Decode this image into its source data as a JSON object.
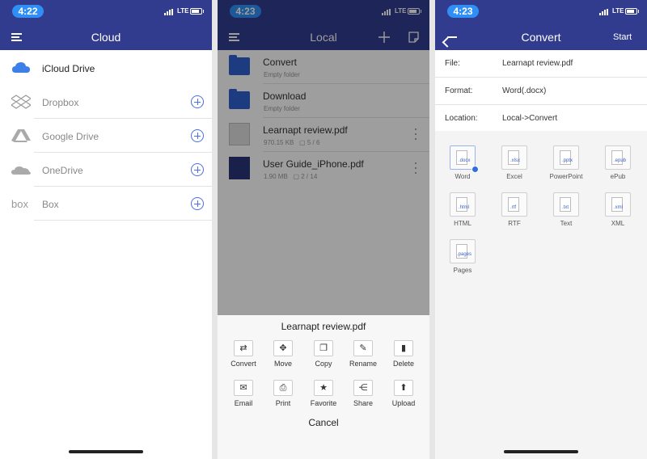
{
  "colors": {
    "header_bg": "#313c8f",
    "accent": "#2f8ff6",
    "folder": "#2f5fd1"
  },
  "screen1": {
    "status_time": "4:22",
    "network": "LTE",
    "title": "Cloud",
    "items": [
      {
        "label": "iCloud Drive",
        "icon": "cloud-icon"
      },
      {
        "label": "Dropbox",
        "icon": "dropbox-icon"
      },
      {
        "label": "Google Drive",
        "icon": "google-drive-icon"
      },
      {
        "label": "OneDrive",
        "icon": "onedrive-icon"
      },
      {
        "label": "Box",
        "icon": "box-icon"
      }
    ]
  },
  "screen2": {
    "status_time": "4:23",
    "network": "LTE",
    "title": "Local",
    "files": [
      {
        "name": "Convert",
        "meta": "Empty folder"
      },
      {
        "name": "Download",
        "meta": "Empty folder"
      },
      {
        "name": "Learnapt review.pdf",
        "size": "970.15 KB",
        "pages": "5 / 6"
      },
      {
        "name": "User Guide_iPhone.pdf",
        "size": "1.90 MB",
        "pages": "2 / 14"
      }
    ],
    "sheet_title": "Learnapt review.pdf",
    "actions": [
      "Convert",
      "Move",
      "Copy",
      "Rename",
      "Delete",
      "Email",
      "Print",
      "Favorite",
      "Share",
      "Upload"
    ],
    "cancel": "Cancel"
  },
  "screen3": {
    "status_time": "4:23",
    "network": "LTE",
    "title": "Convert",
    "start": "Start",
    "info": [
      {
        "key": "File:",
        "value": "Learnapt review.pdf"
      },
      {
        "key": "Format:",
        "value": "Word(.docx)"
      },
      {
        "key": "Location:",
        "value": "Local->Convert"
      }
    ],
    "formats": [
      {
        "label": "Word",
        "ext": ".docx"
      },
      {
        "label": "Excel",
        "ext": ".xlsx"
      },
      {
        "label": "PowerPoint",
        "ext": ".pptx"
      },
      {
        "label": "ePub",
        "ext": ".epub"
      },
      {
        "label": "HTML",
        "ext": ".html"
      },
      {
        "label": "RTF",
        "ext": ".rtf"
      },
      {
        "label": "Text",
        "ext": ".txt"
      },
      {
        "label": "XML",
        "ext": ".xml"
      },
      {
        "label": "Pages",
        "ext": ".pages"
      }
    ]
  }
}
